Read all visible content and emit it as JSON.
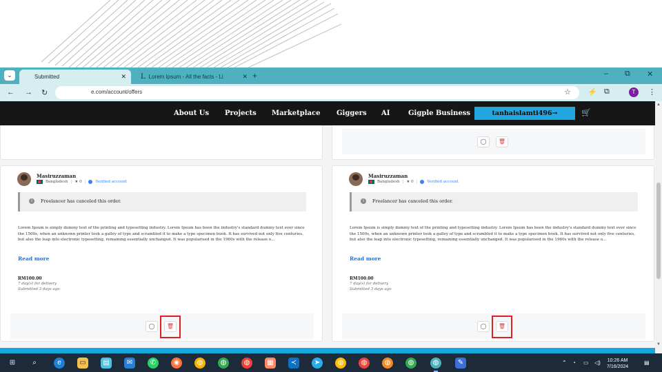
{
  "browser": {
    "tabs": [
      {
        "title": "Submitted",
        "active": true
      },
      {
        "title": "Lorem Ipsum - All the facts - Li",
        "active": false
      }
    ],
    "new_tab_symbol": "+",
    "url": "e.com/account/offers",
    "profile_initial": "T",
    "window_controls": [
      "–",
      "⧉",
      "✕"
    ]
  },
  "site_nav": {
    "links": [
      "About Us",
      "Projects",
      "Marketplace",
      "Giggers",
      "AI",
      "Gigple Business"
    ],
    "user_button": "tanhaislamti496→"
  },
  "cards": [
    {
      "username": "Masiruzzaman",
      "country": "Bangladesh",
      "rating": "★ 0",
      "verified": "Verified account",
      "notice": "Freelancer has canceled this order.",
      "description": "Lorem Ipsum is simply dummy text of the printing and typesetting industry. Lorem Ipsum has been the industry's standard dummy text ever since the 1500s, when an unknown printer took a galley of type and scrambled it to make a type specimen book. It has survived not only five centuries, but also the leap into electronic typesetting, remaining essentially unchanged. It was popularised in the 1960s with the release o...",
      "read_more": "Read more",
      "price": "RM100.00",
      "delivery": "7 day(s) for delivery",
      "submitted": "Submitted 3 days ago"
    },
    {
      "username": "Masiruzzaman",
      "country": "Bangladesh",
      "rating": "★ 0",
      "verified": "Verified account",
      "notice": "Freelancer has canceled this order.",
      "description": "Lorem Ipsum is simply dummy text of the printing and typesetting industry. Lorem Ipsum has been the industry's standard dummy text ever since the 1500s, when an unknown printer took a galley of type and scrambled it to make a type specimen book. It has survived not only five centuries, but also the leap into electronic typesetting, remaining essentially unchanged. It was popularised in the 1960s with the release o...",
      "read_more": "Read more",
      "price": "RM100.00",
      "delivery": "7 day(s) for delivery",
      "submitted": "Submitted 3 days ago"
    }
  ],
  "taskbar": {
    "time": "10:26 AM",
    "date": "7/16/2024"
  },
  "colors": {
    "browser_accent": "#4fb1bf",
    "nav_bg": "#161616",
    "user_button": "#22a7e0",
    "trash_highlight": "#e02020",
    "link": "#1e6fd9"
  }
}
